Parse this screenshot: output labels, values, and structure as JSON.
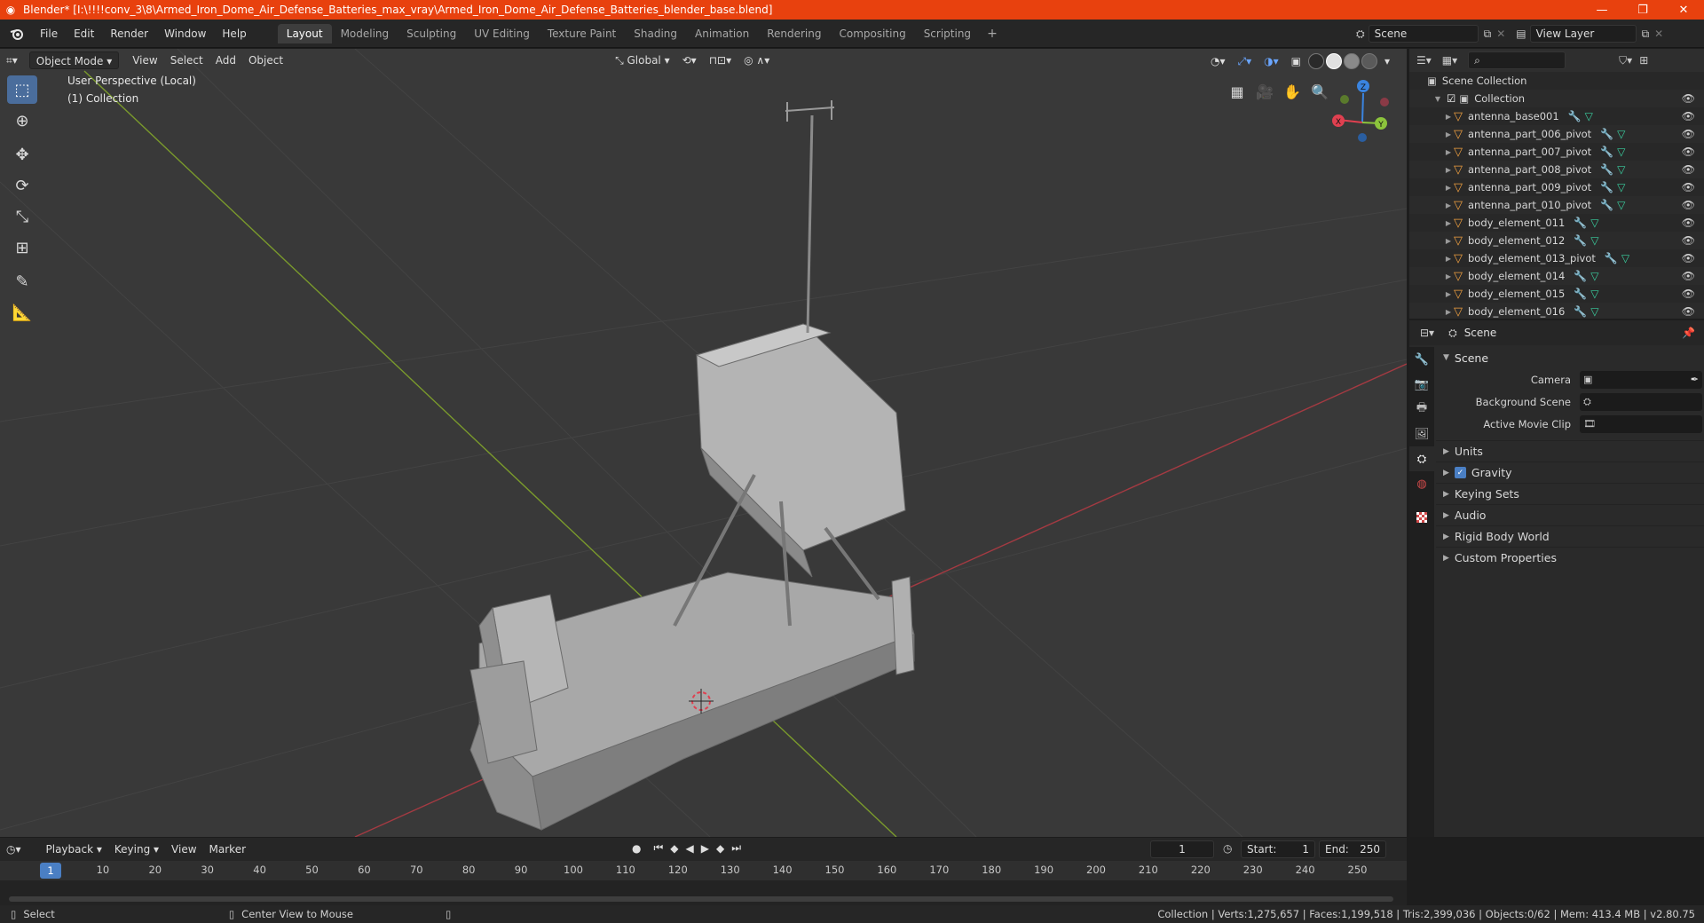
{
  "window": {
    "title": "Blender* [I:\\!!!!conv_3\\8\\Armed_Iron_Dome_Air_Defense_Batteries_max_vray\\Armed_Iron_Dome_Air_Defense_Batteries_blender_base.blend]",
    "minimize": "—",
    "maximize": "❐",
    "close": "✕"
  },
  "menu": [
    "File",
    "Edit",
    "Render",
    "Window",
    "Help"
  ],
  "workspaces": [
    "Layout",
    "Modeling",
    "Sculpting",
    "UV Editing",
    "Texture Paint",
    "Shading",
    "Animation",
    "Rendering",
    "Compositing",
    "Scripting"
  ],
  "active_workspace": "Layout",
  "scene_selector": {
    "label": "Scene"
  },
  "view_layer_selector": {
    "label": "View Layer"
  },
  "viewport": {
    "mode": "Object Mode",
    "menus": [
      "View",
      "Select",
      "Add",
      "Object"
    ],
    "transform_orientation": "Global",
    "perspective_label": "User Perspective (Local)",
    "collection_label": "(1) Collection",
    "gizmo_axes": {
      "x": "X",
      "y": "Y",
      "z": "Z"
    }
  },
  "outliner": {
    "root": "Scene Collection",
    "collection": "Collection",
    "objects": [
      "antenna_base001",
      "antenna_part_006_pivot",
      "antenna_part_007_pivot",
      "antenna_part_008_pivot",
      "antenna_part_009_pivot",
      "antenna_part_010_pivot",
      "body_element_011",
      "body_element_012",
      "body_element_013_pivot",
      "body_element_014",
      "body_element_015",
      "body_element_016"
    ]
  },
  "properties": {
    "context": "Scene",
    "panel": "Scene",
    "fields": [
      {
        "label": "Camera",
        "value": ""
      },
      {
        "label": "Background Scene",
        "value": ""
      },
      {
        "label": "Active Movie Clip",
        "value": ""
      }
    ],
    "subpanels": [
      "Units",
      "Gravity",
      "Keying Sets",
      "Audio",
      "Rigid Body World",
      "Custom Properties"
    ],
    "gravity_checked": true
  },
  "timeline": {
    "menus": [
      "Playback",
      "Keying",
      "View",
      "Marker"
    ],
    "current_frame": "1",
    "start_label": "Start:",
    "start": "1",
    "end_label": "End:",
    "end": "250",
    "ruler": [
      "1",
      "10",
      "20",
      "30",
      "40",
      "50",
      "60",
      "70",
      "80",
      "90",
      "100",
      "110",
      "120",
      "130",
      "140",
      "150",
      "160",
      "170",
      "180",
      "190",
      "200",
      "210",
      "220",
      "230",
      "240",
      "250"
    ]
  },
  "status": {
    "left_action": "Select",
    "middle_action": "Center View to Mouse",
    "stats": "Collection | Verts:1,275,657 | Faces:1,199,518 | Tris:2,399,036 | Objects:0/62 | Mem: 413.4 MB | v2.80.75"
  },
  "colors": {
    "titlebar": "#e8410e",
    "accent": "#4a7fc4",
    "x_axis": "#e04050",
    "y_axis": "#8cc43c",
    "z_axis": "#3a84e0"
  }
}
